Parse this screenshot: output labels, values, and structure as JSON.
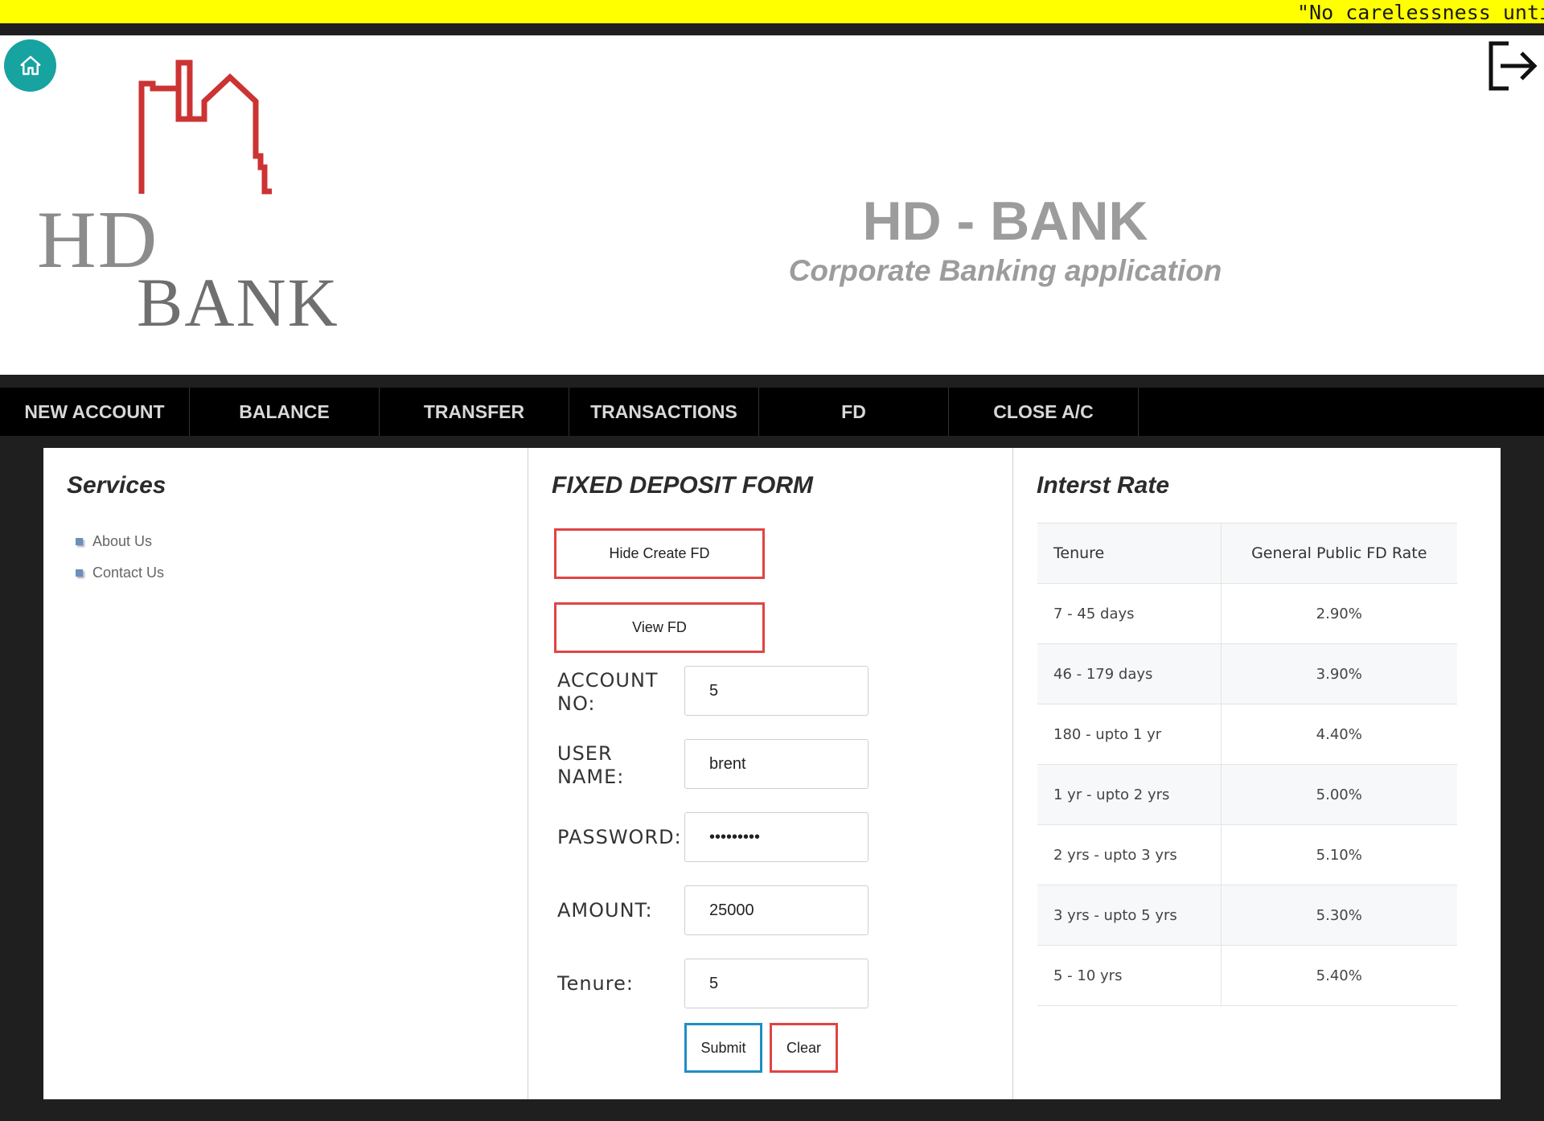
{
  "marquee": {
    "text": "\"No carelessness until the"
  },
  "header": {
    "title": "HD - BANK",
    "subtitle": "Corporate Banking application",
    "logo": {
      "line1": "HD",
      "line2": "BANK"
    },
    "home_icon": "home-icon",
    "logout_icon": "logout-icon"
  },
  "nav": {
    "items": [
      {
        "label": "NEW ACCOUNT"
      },
      {
        "label": "BALANCE"
      },
      {
        "label": "TRANSFER"
      },
      {
        "label": "TRANSACTIONS"
      },
      {
        "label": "FD"
      },
      {
        "label": "CLOSE A/C"
      }
    ]
  },
  "services": {
    "heading": "Services",
    "items": [
      {
        "label": "About Us"
      },
      {
        "label": "Contact Us"
      }
    ]
  },
  "form": {
    "heading": "FIXED DEPOSIT FORM",
    "hide_create_label": "Hide Create FD",
    "view_fd_label": "View FD",
    "fields": {
      "account_no": {
        "label_line1": "ACCOUNT",
        "label_line2": "NO:",
        "value": "5"
      },
      "user_name": {
        "label_line1": "USER",
        "label_line2": "NAME:",
        "value": "brent"
      },
      "password": {
        "label": "PASSWORD:",
        "value": "•••••••••"
      },
      "amount": {
        "label": "AMOUNT:",
        "value": "25000"
      },
      "tenure": {
        "label": "Tenure:",
        "value": "5"
      }
    },
    "submit_label": "Submit",
    "clear_label": "Clear"
  },
  "rates": {
    "heading": "Interst Rate",
    "columns": [
      "Tenure",
      "General Public FD Rate"
    ],
    "rows": [
      {
        "tenure": "7 - 45 days",
        "rate": "2.90%"
      },
      {
        "tenure": "46 - 179 days",
        "rate": "3.90%"
      },
      {
        "tenure": "180 - upto 1 yr",
        "rate": "4.40%"
      },
      {
        "tenure": "1 yr - upto 2 yrs",
        "rate": "5.00%"
      },
      {
        "tenure": "2 yrs - upto 3 yrs",
        "rate": "5.10%"
      },
      {
        "tenure": "3 yrs - upto 5 yrs",
        "rate": "5.30%"
      },
      {
        "tenure": "5 - 10 yrs",
        "rate": "5.40%"
      }
    ]
  },
  "colors": {
    "marquee_bg": "#ffff00",
    "home_button": "#17a3a0",
    "logo_red": "#cc3333",
    "button_border_red": "#e04444",
    "button_border_blue": "#1f8ec4"
  }
}
